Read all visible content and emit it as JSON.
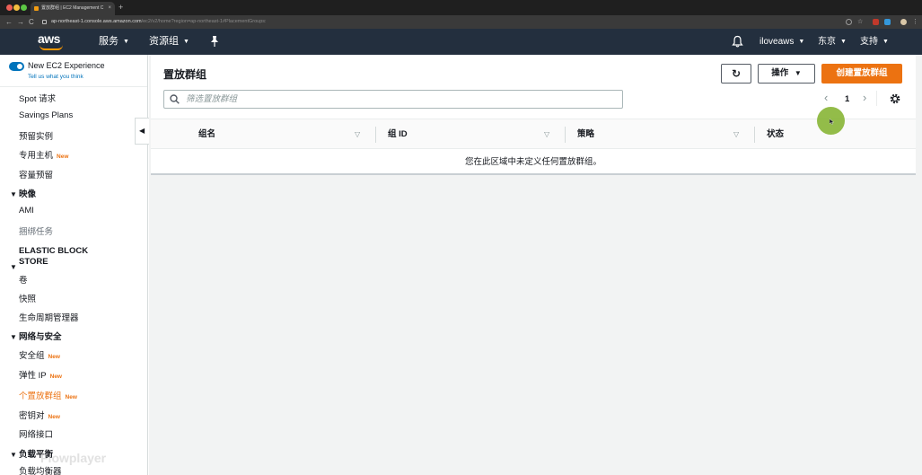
{
  "browser": {
    "tab_title": "置放群组 | EC2 Management C",
    "tab_close": "×",
    "new_tab": "+",
    "url_host": "ap-northeast-1.console.aws.amazon.com",
    "url_path": "/ec2/v2/home?region=ap-northeast-1#PlacementGroups:",
    "back": "←",
    "forward": "→",
    "reload": "C"
  },
  "topnav": {
    "logo": "aws",
    "services": "服务",
    "resource_groups": "资源组",
    "user": "iloveaws",
    "region": "东京",
    "support": "支持",
    "caret": "▼"
  },
  "sidebar": {
    "new_experience": "New EC2 Experience",
    "tell_us": "Tell us what you think",
    "items": [
      {
        "label": "Spot 请求"
      },
      {
        "label": "Savings Plans"
      },
      {
        "label": "预留实例"
      },
      {
        "label": "专用主机",
        "badge": "New"
      },
      {
        "label": "容量预留"
      }
    ],
    "section_images": "映像",
    "images_items": [
      {
        "label": "AMI"
      },
      {
        "label": "捆绑任务"
      }
    ],
    "section_ebs_line1": "ELASTIC BLOCK",
    "section_ebs_line2": "STORE",
    "ebs_items": [
      {
        "label": "卷"
      },
      {
        "label": "快照"
      },
      {
        "label": "生命周期管理器"
      }
    ],
    "section_network": "网络与安全",
    "network_items": [
      {
        "label": "安全组",
        "badge": "New"
      },
      {
        "label": "弹性 IP",
        "badge": "New"
      },
      {
        "label": "个置放群组",
        "badge": "New"
      },
      {
        "label": "密钥对",
        "badge": "New"
      },
      {
        "label": "网络接口"
      }
    ],
    "section_lb": "负载平衡",
    "lb_items": [
      {
        "label": "负载均衡器"
      }
    ],
    "tri": "▼",
    "watermark": "Flowplayer",
    "collapse": "◀"
  },
  "main": {
    "title": "置放群组",
    "refresh": "↻",
    "actions": "操作",
    "actions_caret": "▼",
    "create": "创建置放群组",
    "search_placeholder": "筛选置放群组",
    "pager_prev": "‹",
    "page": "1",
    "pager_next": "›",
    "columns": [
      "组名",
      "组 ID",
      "策略",
      "状态"
    ],
    "sort": "▽",
    "empty": "您在此区域中未定义任何置放群组。"
  },
  "colors": {
    "nav_bg": "#232f3e",
    "accent": "#ec7211",
    "link": "#0073bb"
  }
}
